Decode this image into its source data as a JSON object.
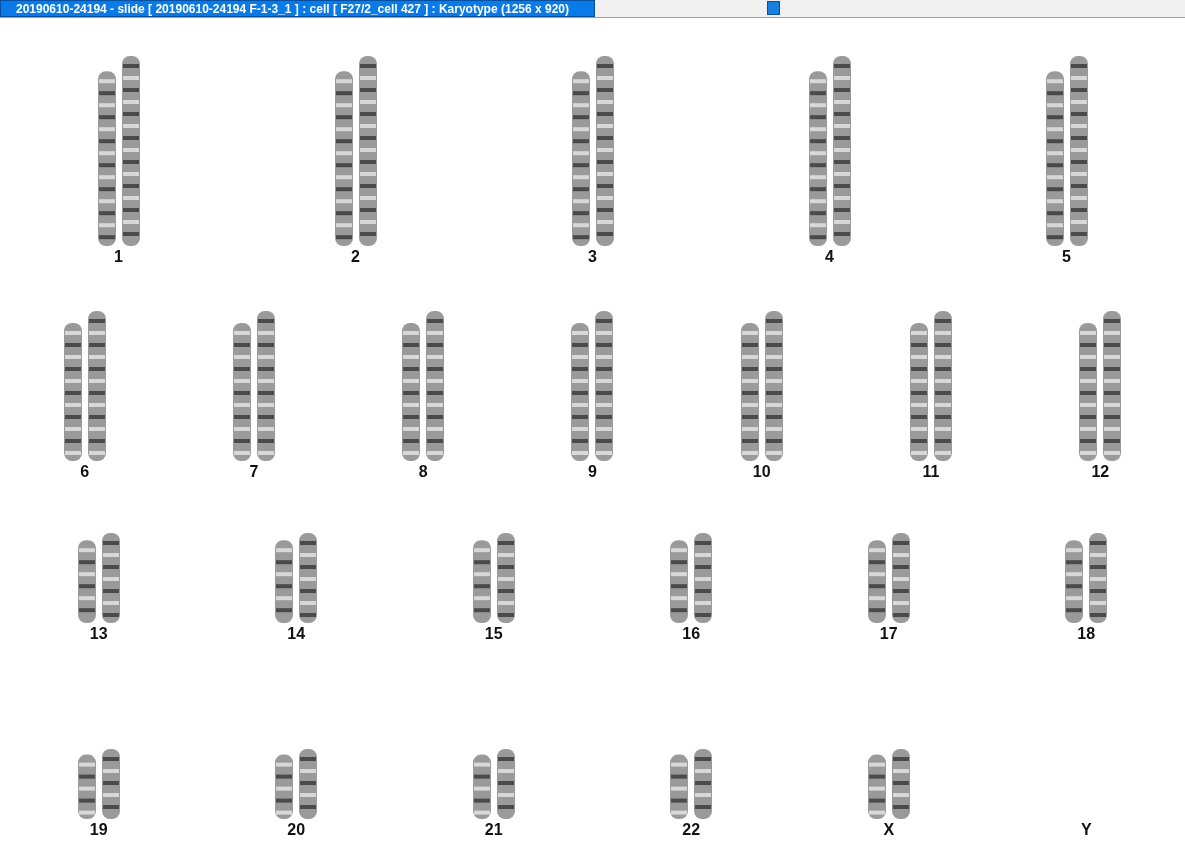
{
  "window": {
    "title": "20190610-24194 - slide [ 20190610-24194 F-1-3_1 ] : cell [ F27/2_cell 427 ] : Karyotype  (1256 x 920)"
  },
  "karyotype": {
    "rows": [
      [
        {
          "label": "1",
          "kind": "pair"
        },
        {
          "label": "2",
          "kind": "pair"
        },
        {
          "label": "3",
          "kind": "pair"
        },
        {
          "label": "4",
          "kind": "pair"
        },
        {
          "label": "5",
          "kind": "pair"
        }
      ],
      [
        {
          "label": "6",
          "kind": "pair"
        },
        {
          "label": "7",
          "kind": "pair"
        },
        {
          "label": "8",
          "kind": "pair"
        },
        {
          "label": "9",
          "kind": "pair"
        },
        {
          "label": "10",
          "kind": "pair"
        },
        {
          "label": "11",
          "kind": "pair"
        },
        {
          "label": "12",
          "kind": "pair"
        }
      ],
      [
        {
          "label": "13",
          "kind": "pair"
        },
        {
          "label": "14",
          "kind": "pair"
        },
        {
          "label": "15",
          "kind": "pair"
        },
        {
          "label": "16",
          "kind": "pair"
        },
        {
          "label": "17",
          "kind": "pair"
        },
        {
          "label": "18",
          "kind": "pair"
        }
      ],
      [
        {
          "label": "19",
          "kind": "pair"
        },
        {
          "label": "20",
          "kind": "pair"
        },
        {
          "label": "21",
          "kind": "pair"
        },
        {
          "label": "22",
          "kind": "pair"
        },
        {
          "label": "X",
          "kind": "pair"
        },
        {
          "label": "Y",
          "kind": "empty"
        }
      ]
    ]
  }
}
